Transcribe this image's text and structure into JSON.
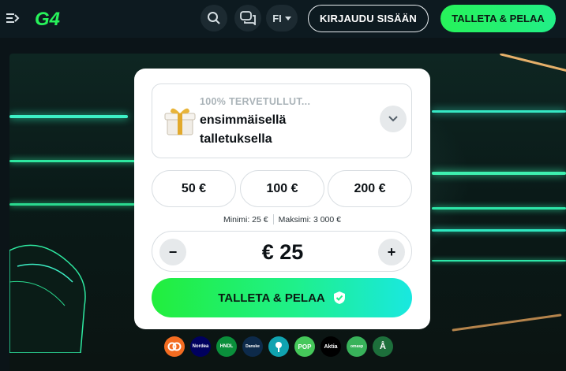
{
  "header": {
    "logo_text": "G4",
    "language": "FI",
    "login_label": "KIRJAUDU SISÄÄN",
    "deposit_label": "TALLETA & PELAA"
  },
  "bonus": {
    "kicker": "100% TERVETULLUT...",
    "title": "ensimmäisellä talletuksella"
  },
  "quick_amounts": [
    "50 €",
    "100 €",
    "200 €"
  ],
  "limits": {
    "min": "Minimi: 25 €",
    "max": "Maksimi: 3 000 €"
  },
  "stepper": {
    "minus": "−",
    "plus": "+",
    "value": "€ 25"
  },
  "cta_label": "TALLETA & PELAA",
  "payment_methods": [
    "OP",
    "Nordea",
    "Handelsbanken",
    "Danske Bank",
    "S-Pankki",
    "POP",
    "Aktia",
    "Oma Säästöpankki",
    "Ålandsbanken"
  ],
  "colors": {
    "accent_green": "#27f25a",
    "header_bg": "#0d1a20",
    "card_bg": "#ffffff"
  }
}
